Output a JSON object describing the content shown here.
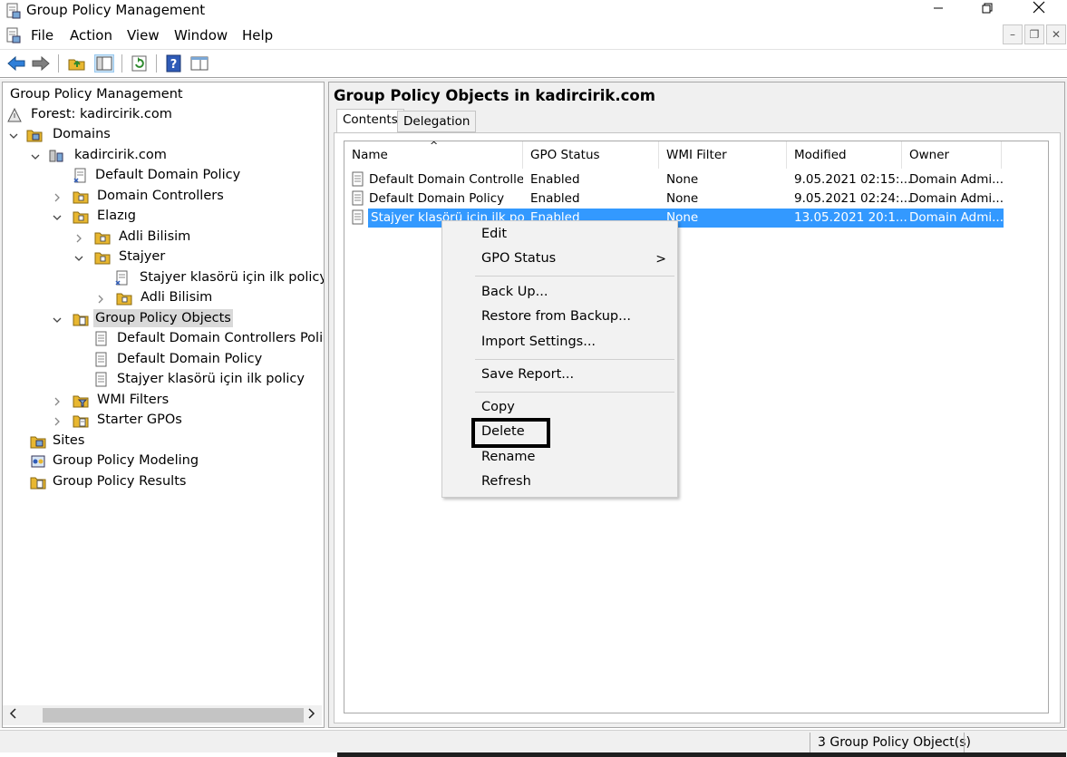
{
  "window": {
    "title": "Group Policy Management"
  },
  "menu": {
    "items": [
      "File",
      "Action",
      "View",
      "Window",
      "Help"
    ]
  },
  "tree": {
    "root": "Group Policy Management",
    "forest": "Forest: kadircirik.com",
    "domains": "Domains",
    "domain": "kadircirik.com",
    "default_domain_policy": "Default Domain Policy",
    "domain_controllers": "Domain Controllers",
    "elazig": "Elazıg",
    "adli_bilisim_1": "Adli Bilisim",
    "stajyer": "Stajyer",
    "stajyer_policy_link": "Stajyer klasörü için ilk policy",
    "adli_bilisim_2": "Adli Bilisim",
    "gpo": "Group Policy Objects",
    "gpo_ddcp": "Default Domain Controllers Policy",
    "gpo_ddp": "Default Domain Policy",
    "gpo_stajyer": "Stajyer klasörü için ilk policy",
    "wmi_filters": "WMI Filters",
    "starter_gpos": "Starter GPOs",
    "sites": "Sites",
    "modeling": "Group Policy Modeling",
    "results": "Group Policy Results"
  },
  "details": {
    "heading": "Group Policy Objects in kadircirik.com",
    "tabs": [
      "Contents",
      "Delegation"
    ],
    "columns": [
      "Name",
      "GPO Status",
      "WMI Filter",
      "Modified",
      "Owner"
    ],
    "rows": [
      {
        "name": "Default Domain Controller...",
        "status": "Enabled",
        "wmi": "None",
        "modified": "9.05.2021 02:15:...",
        "owner": "Domain Admi..."
      },
      {
        "name": "Default Domain Policy",
        "status": "Enabled",
        "wmi": "None",
        "modified": "9.05.2021 02:24:...",
        "owner": "Domain Admi..."
      },
      {
        "name": "Stajyer klasörü için ilk policy",
        "status": "Enabled",
        "wmi": "None",
        "modified": "13.05.2021 20:1...",
        "owner": "Domain Admi..."
      }
    ]
  },
  "context_menu": {
    "edit": "Edit",
    "gpo_status": "GPO Status",
    "submenu_arrow": ">",
    "back_up": "Back Up...",
    "restore": "Restore from Backup...",
    "import": "Import Settings...",
    "save_report": "Save Report...",
    "copy": "Copy",
    "delete": "Delete",
    "rename": "Rename",
    "refresh": "Refresh"
  },
  "status": {
    "count": "3 Group Policy Object(s)"
  },
  "colors": {
    "selection": "#3399ff",
    "folder": "#e8b730"
  }
}
